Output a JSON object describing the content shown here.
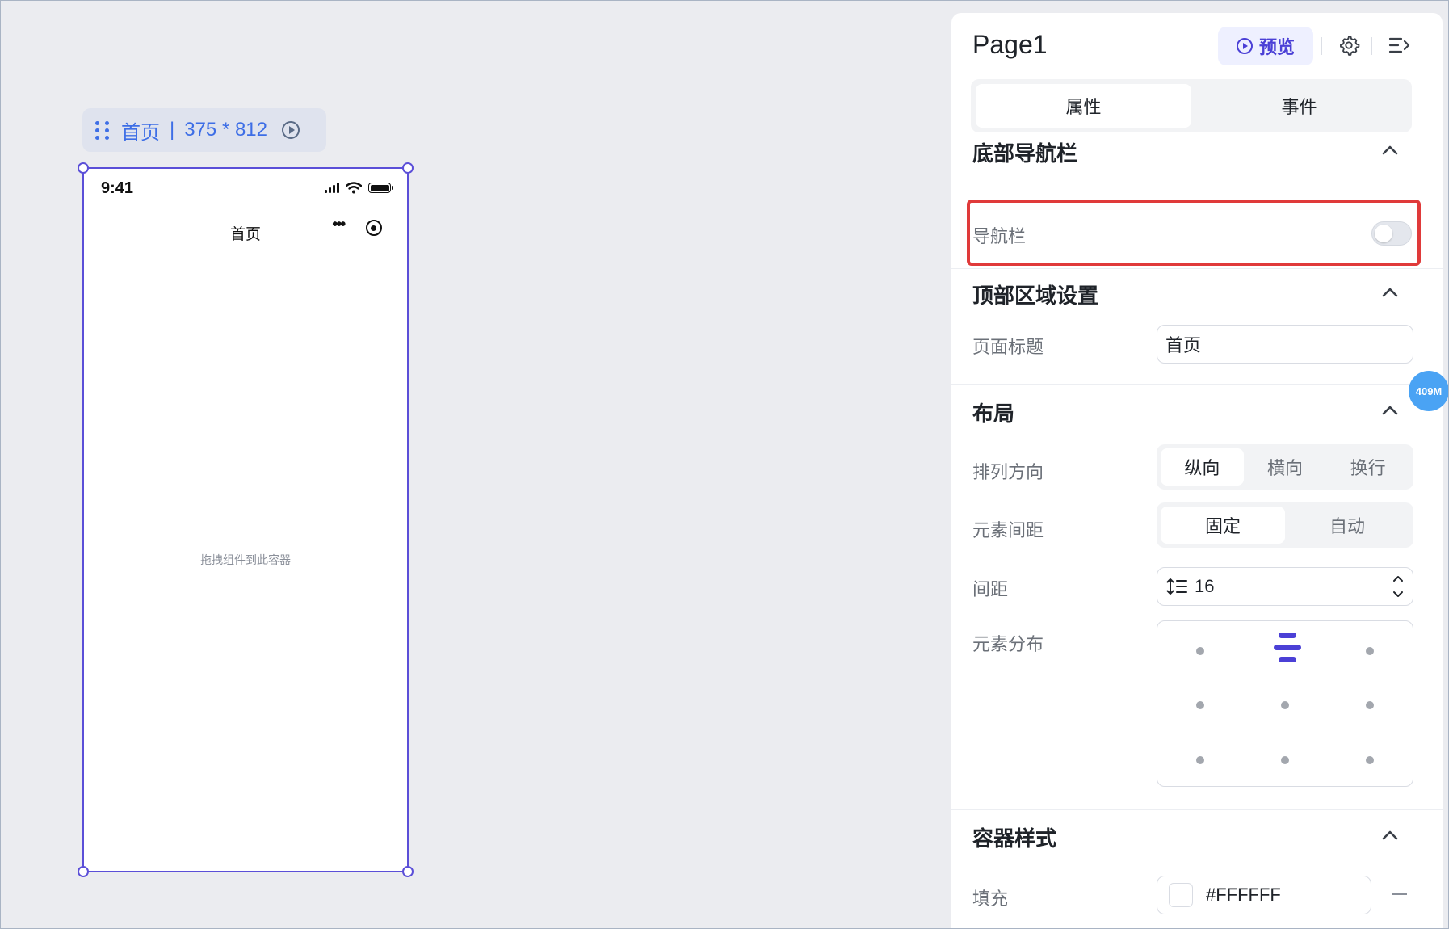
{
  "canvas": {
    "page_tag": {
      "name": "首页",
      "separator": "|",
      "size": "375 * 812"
    },
    "phone": {
      "time": "9:41",
      "nav_title": "首页",
      "drop_hint": "拖拽组件到此容器"
    }
  },
  "panel": {
    "title": "Page1",
    "preview_label": "预览",
    "tabs": [
      {
        "label": "属性",
        "active": true
      },
      {
        "label": "事件",
        "active": false
      }
    ],
    "bottom_nav": {
      "title": "底部导航栏",
      "navbar_label": "导航栏",
      "navbar_enabled": false
    },
    "top_area": {
      "title": "顶部区域设置",
      "page_title_label": "页面标题",
      "page_title_value": "首页"
    },
    "layout": {
      "title": "布局",
      "direction_label": "排列方向",
      "direction_options": [
        "纵向",
        "横向",
        "换行"
      ],
      "direction_selected": "纵向",
      "gap_mode_label": "元素间距",
      "gap_mode_options": [
        "固定",
        "自动"
      ],
      "gap_mode_selected": "固定",
      "spacing_label": "间距",
      "spacing_value": "16",
      "distribution_label": "元素分布",
      "distribution_selected": "top-center"
    },
    "container_style": {
      "title": "容器样式",
      "fill_label": "填充",
      "fill_value": "#FFFFFF"
    }
  },
  "memory_badge": "409M",
  "colors": {
    "accent": "#4b40d6",
    "selection": "#5b4fd8",
    "highlight_box": "#e03a3a",
    "tag_text": "#3d6ee6",
    "badge": "#4aa3f4"
  }
}
